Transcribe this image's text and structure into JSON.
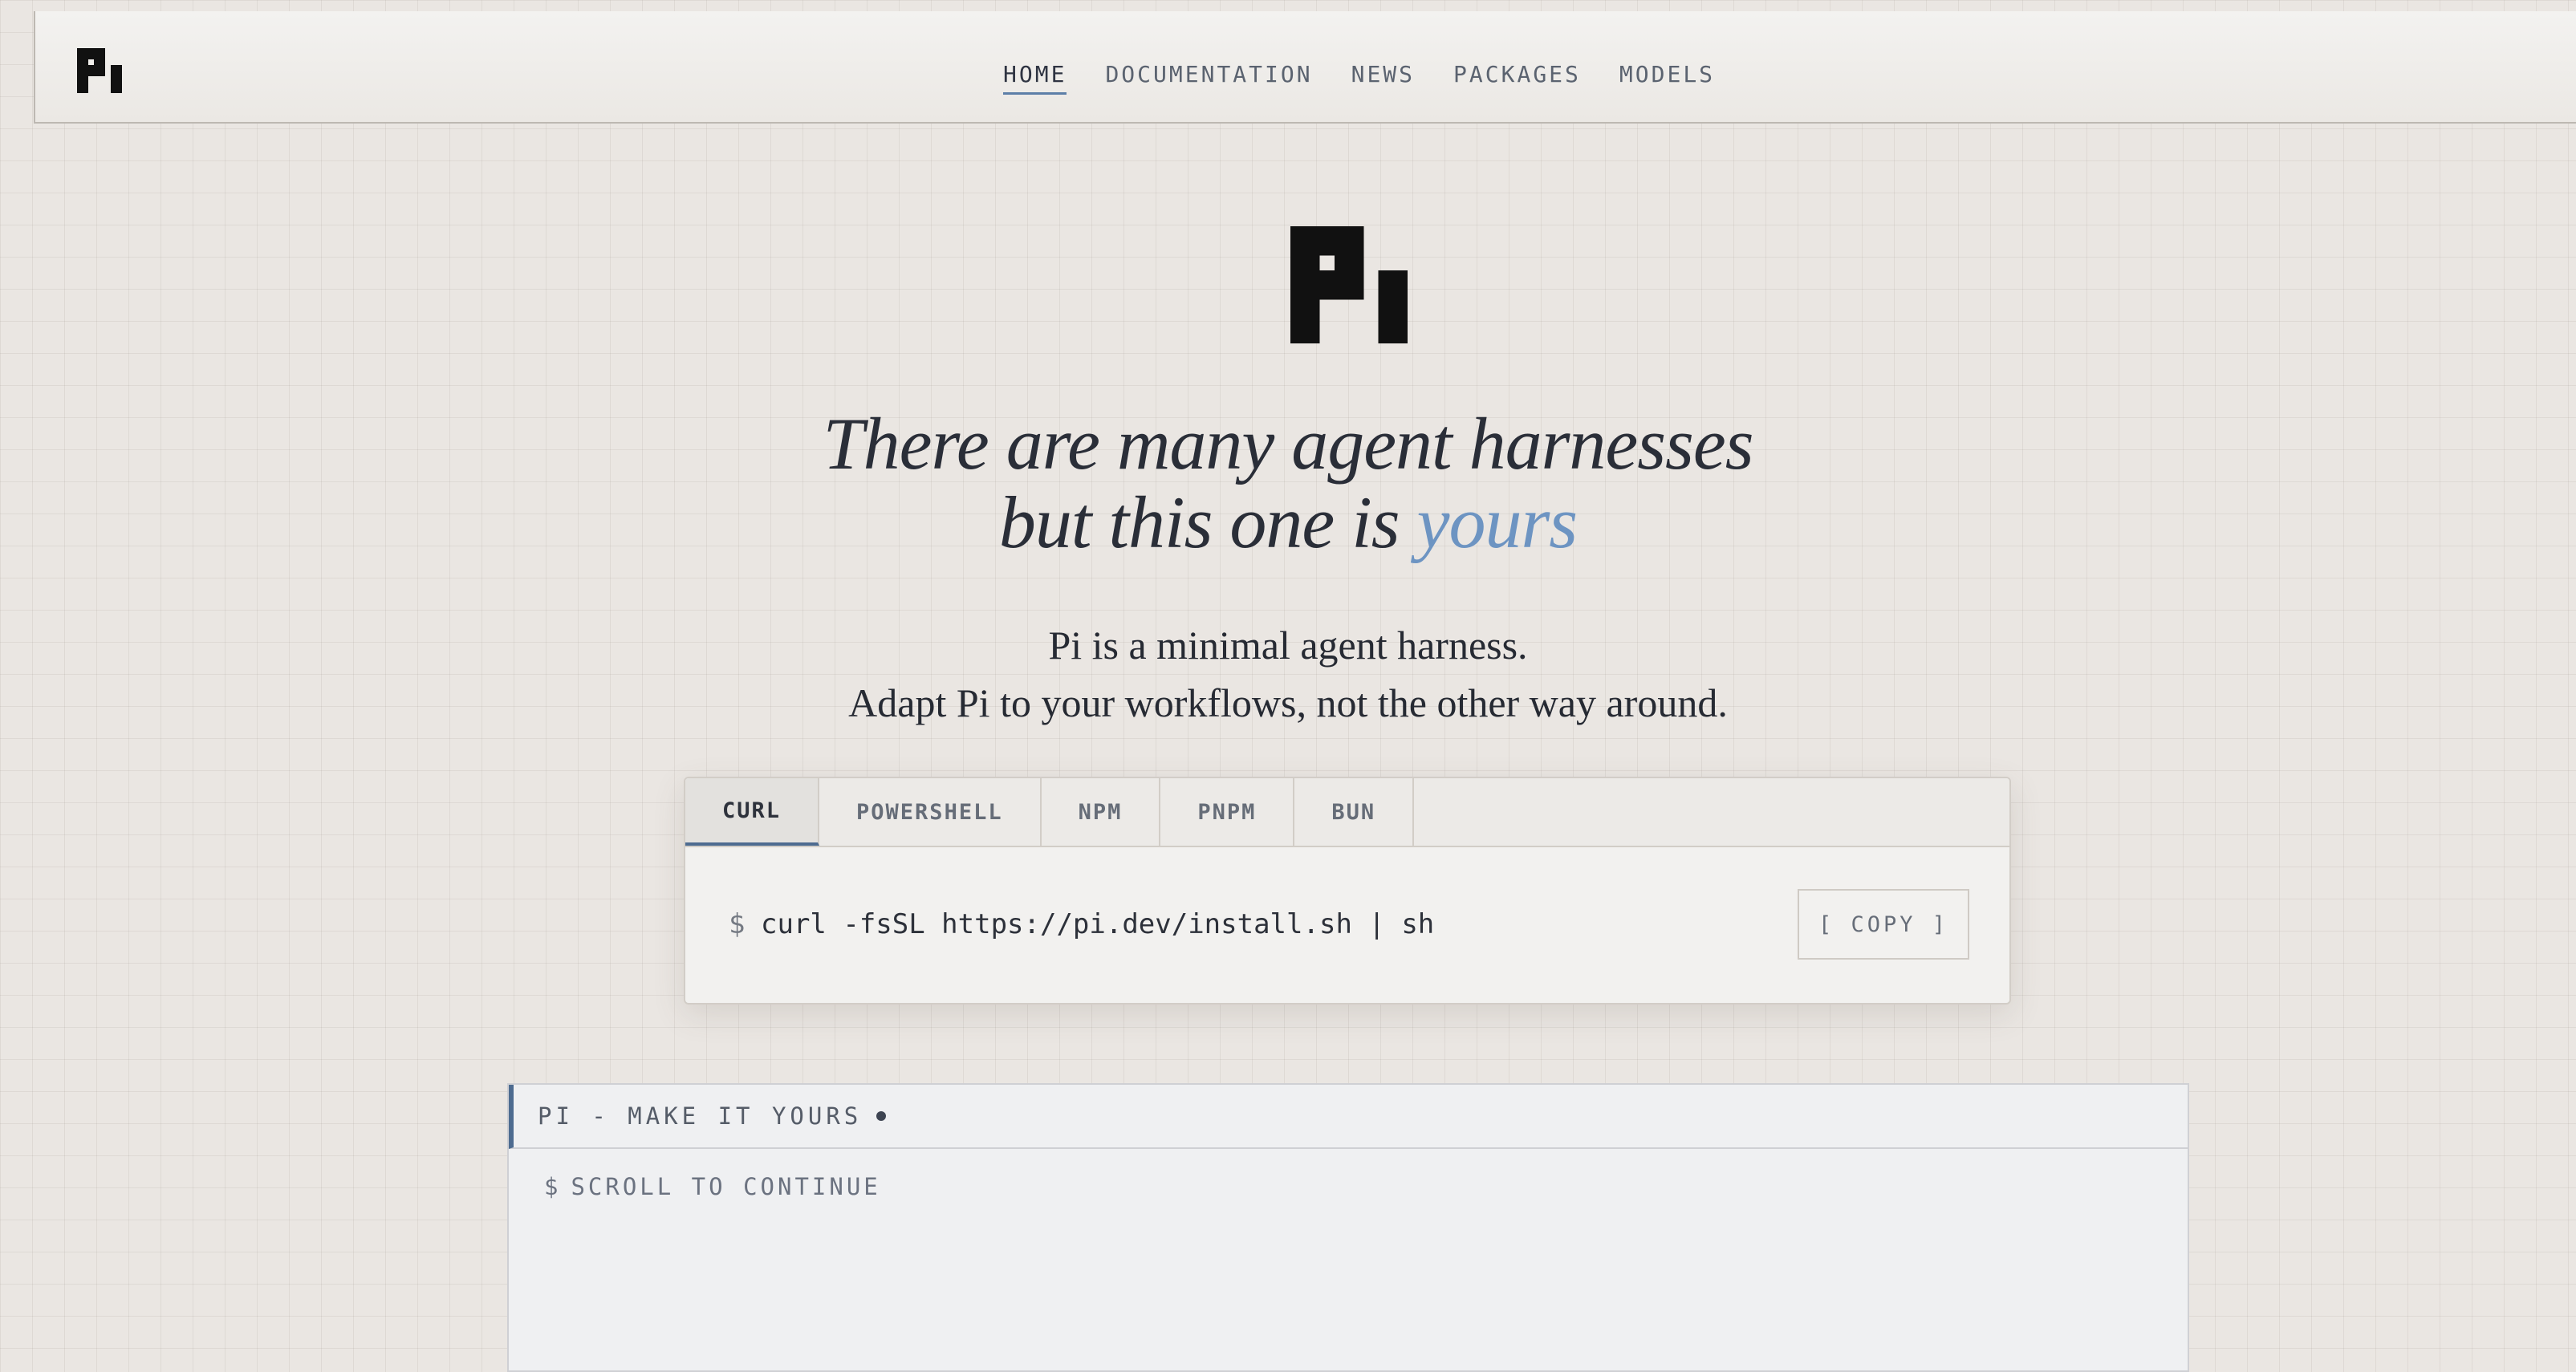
{
  "nav": {
    "brand": "pi-logo",
    "items": [
      {
        "label": "HOME",
        "active": true
      },
      {
        "label": "DOCUMENTATION",
        "active": false
      },
      {
        "label": "NEWS",
        "active": false
      },
      {
        "label": "PACKAGES",
        "active": false
      },
      {
        "label": "MODELS",
        "active": false
      }
    ]
  },
  "hero": {
    "logo": "pi-logo",
    "headline_line1": "There are many agent harnesses",
    "headline_line2_prefix": "but this one is",
    "headline_accent": "yours",
    "tagline_line1": "Pi is a minimal agent harness.",
    "tagline_line2": "Adapt Pi to your workflows, not the other way around."
  },
  "install": {
    "tabs": [
      {
        "label": "CURL",
        "active": true
      },
      {
        "label": "POWERSHELL",
        "active": false
      },
      {
        "label": "NPM",
        "active": false
      },
      {
        "label": "PNPM",
        "active": false
      },
      {
        "label": "BUN",
        "active": false
      }
    ],
    "prompt": "$",
    "command": "curl -fsSL https://pi.dev/install.sh | sh",
    "copy_label": "[ COPY ]"
  },
  "terminal": {
    "title": "PI - MAKE IT YOURS",
    "prompt": "$",
    "line": "SCROLL TO CONTINUE"
  },
  "colors": {
    "accent": "#6d94c2",
    "active_underline": "#4d6b90",
    "text": "#262a33",
    "background": "#eae6e2"
  }
}
